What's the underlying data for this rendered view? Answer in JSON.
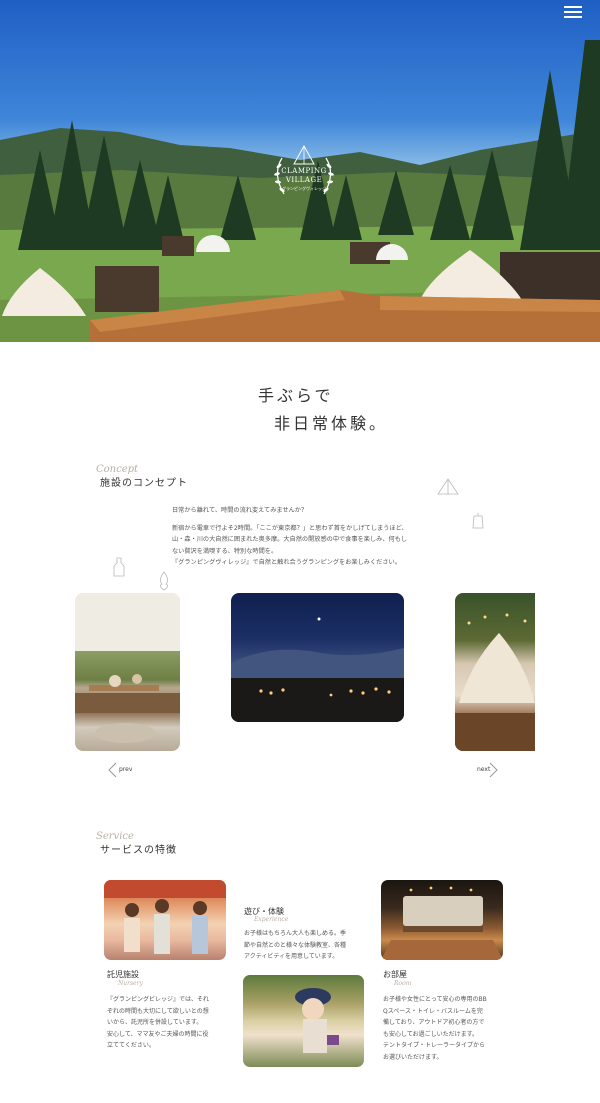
{
  "hero": {
    "menu_icon": "hamburger-menu-icon",
    "logo": {
      "line1": "CLAMPING",
      "line2": "VILLAGE",
      "sub": "グランピングヴィレッジ"
    }
  },
  "headline": {
    "line1": "手ぶらで",
    "line2": "非日常体験。"
  },
  "concept": {
    "en": "Concept",
    "title": "施設のコンセプト",
    "p1": "日常から離れて、時間の流れ変えてみませんか？",
    "p2_l1": "新宿から電車で行よそ2時間。「ここが東京都？」と思わず首をかしげてしまうほど、",
    "p2_l2": "山・森・川の大自然に囲まれた奥多摩。大自然の開放感の中で食事を楽しみ、何もし",
    "p2_l3": "ない贅沢を満喫する、特別な時間を。",
    "p2_l4": "『グランピングヴィレッジ』で自然と触れ合うグランピングをお楽しみください。"
  },
  "slider": {
    "prev": "prev",
    "next": "next"
  },
  "service": {
    "en": "Service",
    "title": "サービスの特徴",
    "items": [
      {
        "ja": "託児施設",
        "en": "Nursery",
        "l1": "『グランピングビレッジ』では、それ",
        "l2": "ぞれの時間も大切にして欲しいとの想",
        "l3": "いから、託児所を併設しています。",
        "l4": "安心して、ママ友やご夫婦の時間に役",
        "l5": "立ててください。"
      },
      {
        "ja": "遊び・体験",
        "en": "Experience",
        "l1": "お子様はもちろん大人も楽しめる。季",
        "l2": "節や自然とのと様々な体験教室、各種",
        "l3": "アクティビティを用意しています。"
      },
      {
        "ja": "お部屋",
        "en": "Room",
        "l1": "お子様や女性にとって安心の専用のBB",
        "l2": "Qスペース・トイレ・バスルームを完",
        "l3": "備しており、アウトドア初心者の方で",
        "l4": "も安心してお過ごしいただけます。",
        "l5": "テントタイプ・トレーラータイプから",
        "l6": "お選びいただけます。"
      }
    ]
  }
}
